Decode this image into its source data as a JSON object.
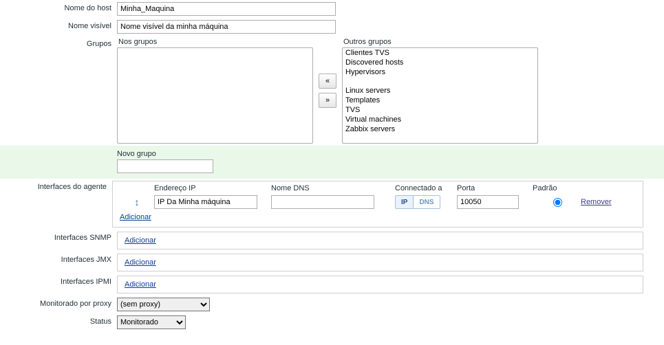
{
  "labels": {
    "host_name": "Nome do host",
    "visible_name": "Nome visível",
    "groups": "Grupos",
    "in_groups": "Nos grupos",
    "other_groups": "Outros grupos",
    "new_group": "Novo grupo",
    "agent_interfaces": "Interfaces do agente",
    "snmp_interfaces": "Interfaces SNMP",
    "jmx_interfaces": "Interfaces JMX",
    "ipmi_interfaces": "Interfaces IPMI",
    "monitored_by_proxy": "Monitorado por proxy",
    "status": "Status"
  },
  "values": {
    "host_name": "Minha_Maquina",
    "visible_name": "Nome visível da minha máquina",
    "new_group": ""
  },
  "buttons": {
    "move_left": "«",
    "move_right": "»"
  },
  "other_groups_options": {
    "0": "Clientes TVS",
    "1": "Discovered hosts",
    "2": "Hypervisors",
    "3": "",
    "4": "Linux servers",
    "5": "Templates",
    "6": "TVS",
    "7": "Virtual machines",
    "8": "Zabbix servers"
  },
  "iface_headers": {
    "ip": "Endereço IP",
    "dns": "Nome DNS",
    "connect": "Connectado a",
    "port": "Porta",
    "default": "Padrão"
  },
  "iface_row": {
    "ip": "IP Da Minha máquina",
    "dns": "",
    "port": "10050",
    "conn_ip": "IP",
    "conn_dns": "DNS"
  },
  "links": {
    "add": "Adicionar",
    "remove": "Remover"
  },
  "proxy": {
    "selected": "(sem proxy)"
  },
  "status_opts": {
    "selected": "Monitorado"
  }
}
